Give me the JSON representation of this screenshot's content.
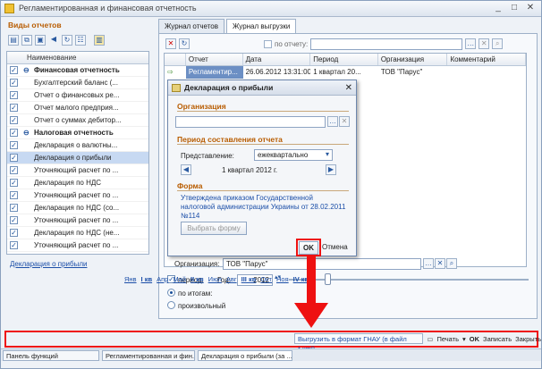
{
  "window": {
    "title": "Регламентированная и финансовая отчетность"
  },
  "left": {
    "header": "Виды отчетов",
    "column": "Наименование",
    "rows": [
      {
        "label": "Финансовая отчетность",
        "group": true,
        "checked": true
      },
      {
        "label": "Бухгалтерский баланс (...",
        "group": false,
        "checked": true
      },
      {
        "label": "Отчет о финансовых ре...",
        "group": false,
        "checked": true
      },
      {
        "label": "Отчет малого предприя...",
        "group": false,
        "checked": true
      },
      {
        "label": "Отчет о суммах дебитор...",
        "group": false,
        "checked": true
      },
      {
        "label": "Налоговая отчетность",
        "group": true,
        "checked": true
      },
      {
        "label": "Декларация о валютны...",
        "group": false,
        "checked": true
      },
      {
        "label": "Декларация о прибыли",
        "group": false,
        "checked": true,
        "selected": true
      },
      {
        "label": "Уточняющий расчет по ...",
        "group": false,
        "checked": true
      },
      {
        "label": "Декларация по НДС",
        "group": false,
        "checked": true
      },
      {
        "label": "Уточняющий расчет по ...",
        "group": false,
        "checked": true
      },
      {
        "label": "Декларация по НДС (со...",
        "group": false,
        "checked": true
      },
      {
        "label": "Уточняющий расчет по ...",
        "group": false,
        "checked": true
      },
      {
        "label": "Декларация по НДС (не...",
        "group": false,
        "checked": true
      },
      {
        "label": "Уточняющий расчет по ...",
        "group": false,
        "checked": true
      }
    ],
    "footer_link": "Декларация о прибыли"
  },
  "tabs": [
    "Журнал отчетов",
    "Журнал выгрузки"
  ],
  "filter": {
    "label": "по отчету:"
  },
  "grid": {
    "columns": [
      "Отчет",
      "Дата",
      "Период",
      "Организация",
      "Комментарий"
    ],
    "row": {
      "report": "Регламентир...",
      "date": "26.06.2012 13:31:00",
      "period": "1 квартал 20...",
      "org": "ТОВ \"Парус\"",
      "comment": ""
    }
  },
  "dialog": {
    "title": "Декларация о прибыли",
    "org_section": "Организация",
    "org_value": "",
    "period_section": "Период составления отчета",
    "presentation_label": "Представление:",
    "presentation_value": "ежеквартально",
    "period_value": "1 квартал 2012 г.",
    "form_section": "Форма",
    "form_text": "Утверждена приказом Государственной налоговой администрации Украины от 28.02.2011 №114",
    "choose_form": "Выбрать форму",
    "ok": "OK",
    "cancel": "Отмена"
  },
  "bottom": {
    "org_label": "Организация:",
    "org_value": "ТОВ \"Парус\"",
    "period_label": "период:",
    "year_label": "Год:",
    "year_value": "2012",
    "by_totals": "по итогам:",
    "arbitrary": "произвольный",
    "months": [
      "Янв",
      "I кв",
      "Апр",
      "Май",
      "II кв",
      "Июл",
      "Авг",
      "III кв",
      "Окт",
      "Ноя",
      "IV кв"
    ]
  },
  "commands": {
    "export": "Выгрузить в формат ГНАУ (в файл *.xml)",
    "print": "Печать",
    "ok": "OK",
    "save": "Записать",
    "close": "Закрыть"
  },
  "taskbar": [
    "Панель функций",
    "Регламентированная и фин...",
    "Декларация о прибыли (за ..."
  ]
}
